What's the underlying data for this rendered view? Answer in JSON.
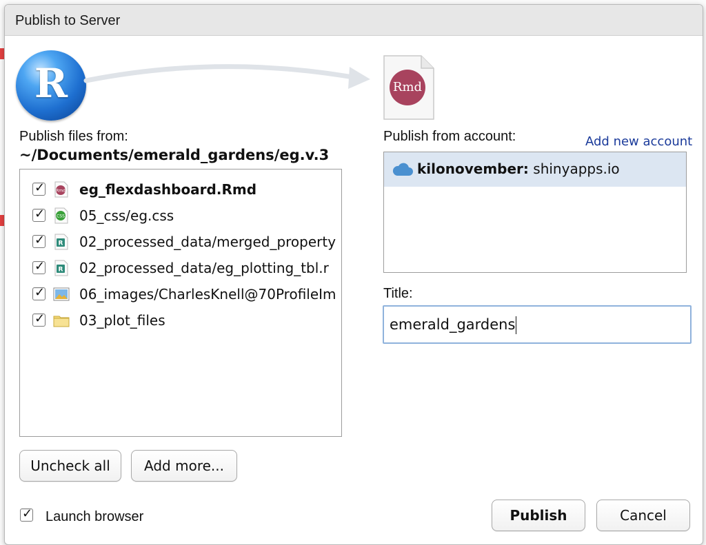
{
  "dialog": {
    "title": "Publish to Server"
  },
  "files": {
    "heading": "Publish files from:",
    "path": "~/Documents/emerald_gardens/eg.v.3",
    "items": [
      {
        "name": "eg_flexdashboard.Rmd",
        "checked": true,
        "icon": "rmd-file-icon",
        "bold": true
      },
      {
        "name": "05_css/eg.css",
        "checked": true,
        "icon": "css-file-icon",
        "bold": false
      },
      {
        "name": "02_processed_data/merged_property",
        "checked": true,
        "icon": "r-data-file-icon",
        "bold": false
      },
      {
        "name": "02_processed_data/eg_plotting_tbl.r",
        "checked": true,
        "icon": "r-data-file-icon",
        "bold": false
      },
      {
        "name": "06_images/CharlesKnell@70ProfileIm",
        "checked": true,
        "icon": "image-file-icon",
        "bold": false
      },
      {
        "name": "03_plot_files",
        "checked": true,
        "icon": "folder-icon",
        "bold": false
      }
    ],
    "uncheck_all_label": "Uncheck all",
    "add_more_label": "Add more..."
  },
  "account": {
    "heading": "Publish from account:",
    "add_new_label": "Add new account",
    "selected_name": "kilonovember:",
    "selected_server": "shinyapps.io"
  },
  "title_field": {
    "label": "Title:",
    "value": "emerald_gardens"
  },
  "launch_browser": {
    "label": "Launch browser",
    "checked": true
  },
  "actions": {
    "publish_label": "Publish",
    "cancel_label": "Cancel"
  },
  "icons": {
    "r_logo_letter": "R",
    "rmd_badge": "Rmd"
  },
  "colors": {
    "accent_link": "#1a3a9a",
    "selection": "#dce6f2",
    "rmd_brand": "#a8435e",
    "r_blue": "#1e6fd0"
  }
}
